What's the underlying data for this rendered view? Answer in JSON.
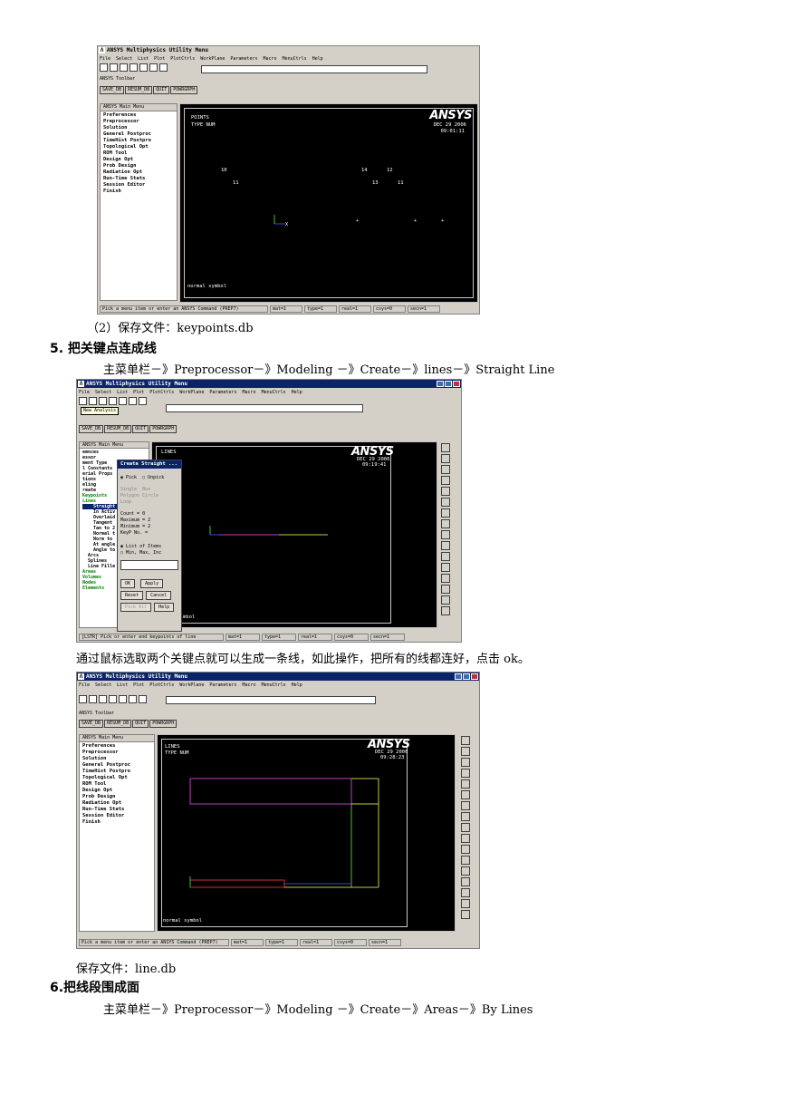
{
  "doc": {
    "step4_save": "（2）保存文件：keypoints.db",
    "section5_heading": "5. 把关键点连成线",
    "section5_path": "主菜单栏－》Preprocessor－》Modeling －》Create－》lines－》Straight Line",
    "section5_desc": "通过鼠标选取两个关键点就可以生成一条线，如此操作，把所有的线都连好，点击 ok。",
    "section5_save": "保存文件：line.db",
    "section6_heading": "6.把线段围成面",
    "section6_path": "主菜单栏－》Preprocessor－》Modeling －》Create－》Areas－》By Lines"
  },
  "ansys": {
    "title": "ANSYS Multiphysics Utility Menu",
    "menu": [
      "File",
      "Select",
      "List",
      "Plot",
      "PlotCtrls",
      "WorkPlane",
      "Parameters",
      "Macro",
      "MenuCtrls",
      "Help"
    ],
    "toolbar_label": "ANSYS Toolbar",
    "toolbar_buttons": [
      "SAVE_DB",
      "RESUM_DB",
      "QUIT",
      "POWRGRPH"
    ],
    "main_menu_title": "ANSYS Main Menu",
    "main_menu": [
      "Preferences",
      "Preprocessor",
      "Solution",
      "General Postproc",
      "TimeHist Postpro",
      "Topological Opt",
      "ROM Tool",
      "Design Opt",
      "Prob Design",
      "Radiation Opt",
      "Run-Time Stats",
      "Session Editor",
      "Finish"
    ],
    "logo": "ANSYS",
    "status_prompt": "Pick a menu item or enter an ANSYS Command (PREP7)",
    "status_fields": [
      "mat=1",
      "type=1",
      "real=1",
      "csys=0",
      "secn=1"
    ]
  },
  "shot1": {
    "label1": "POINTS",
    "label2": "TYPE NUM",
    "date": "DEC 29 2006",
    "time": "09:01:11",
    "kp_labels": [
      "10",
      "14",
      "12",
      "11",
      "13",
      "11"
    ],
    "footer": "normal symbol"
  },
  "shot2": {
    "label1": "LINES",
    "date": "DEC 29 2006",
    "time": "09:19:41",
    "tooltip": "New Analysis",
    "status_prompt": "[LSTR]  Pick or enter end keypoints of line",
    "left_menu": [
      "emnces",
      "essor",
      "ment Type",
      "l Constants",
      "erial Props",
      "tions",
      "eling",
      "reate",
      "Keypoints",
      "Lines",
      "Straight",
      "In Activ",
      "Overlaid",
      "Tangent",
      "Tan to 2",
      "Normal t",
      "Norm to",
      "At angle",
      "Angle to",
      "Arcs",
      "Splines",
      "Line Fille",
      "Areas",
      "Volumes",
      "Nodes",
      "Elements"
    ],
    "dialog": {
      "title": "Create Straight ...",
      "pick": "Pick",
      "unpick": "Unpick",
      "single": "Single",
      "box": "Box",
      "polygon": "Polygon",
      "circle": "Circle",
      "loop": "Loop",
      "count": "Count    =  0",
      "maximum": "Maximum  =  2",
      "minimum": "Minimum  =  2",
      "keyp": "KeyP No. =",
      "list_items": "List of Items",
      "min_max": "Min, Max, Inc",
      "ok": "OK",
      "apply": "Apply",
      "reset": "Reset",
      "cancel": "Cancel",
      "pick_all": "Pick All",
      "help": "Help"
    },
    "footer": "mbol"
  },
  "shot3": {
    "label1": "LINES",
    "label2": "TYPE NUM",
    "date": "DEC 29 2006",
    "time": "09:28:23",
    "footer": "normal symbol"
  },
  "colors": {
    "titlebar": "#0a246a",
    "line_magenta": "#c040c0",
    "line_yellow": "#c8c840",
    "line_blue": "#4040e0",
    "line_red": "#d03030"
  }
}
